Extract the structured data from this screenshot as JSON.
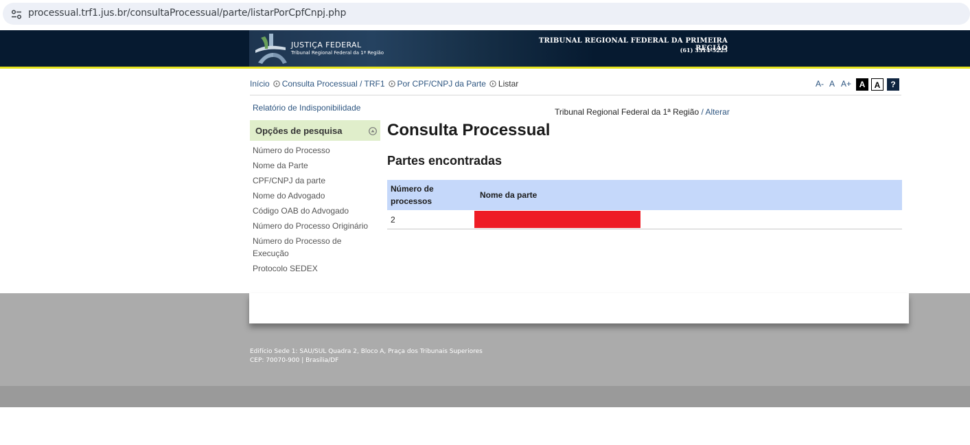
{
  "browser": {
    "url": "processual.trf1.jus.br/consultaProcessual/parte/listarPorCpfCnpj.php",
    "site_info_icon": "tune-icon"
  },
  "header": {
    "logo_title": "JUSTIÇA FEDERAL",
    "logo_subtitle": "Tribunal Regional Federal da 1ª Região",
    "court_name": "TRIBUNAL REGIONAL FEDERAL DA PRIMEIRA REGIÃO",
    "phone": "(61) 3314-5225"
  },
  "breadcrumb": {
    "items": [
      "Início",
      "Consulta Processual / TRF1",
      "Por CPF/CNPJ da Parte"
    ],
    "current": "Listar"
  },
  "font_tools": {
    "decrease": "A-",
    "normal": "A",
    "increase": "A+",
    "contrast_dark": "A",
    "contrast_light": "A",
    "help": "?"
  },
  "sidebar": {
    "report_link": "Relatório de Indisponibilidade",
    "options_title": "Opções de pesquisa",
    "links": [
      "Número do Processo",
      "Nome da Parte",
      "CPF/CNPJ da parte",
      "Nome do Advogado",
      "Código OAB do Advogado",
      "Número do Processo Originário",
      "Número do Processo de Execução",
      "Protocolo SEDEX"
    ]
  },
  "main": {
    "court_label": "Tribunal Regional Federal da 1ª Região",
    "court_sep": " / ",
    "change_link": "Alterar",
    "title": "Consulta Processual",
    "subtitle": "Partes encontradas",
    "table": {
      "headers": [
        "Número de processos",
        "Nome da parte"
      ],
      "rows": [
        {
          "count": "2",
          "name_redacted": true
        }
      ]
    }
  },
  "footer": {
    "address_line1": "Edifício Sede 1: SAU/SUL Quadra 2, Bloco A, Praça dos Tribunais Superiores",
    "address_line2": "CEP: 70070-900 | Brasília/DF"
  },
  "colors": {
    "header_bg": "#061a30",
    "accent_line": "#e5e31c",
    "link": "#2d5580",
    "table_header": "#c5d8fa",
    "options_bg": "#e0eecb",
    "redaction": "#ee1c25"
  }
}
